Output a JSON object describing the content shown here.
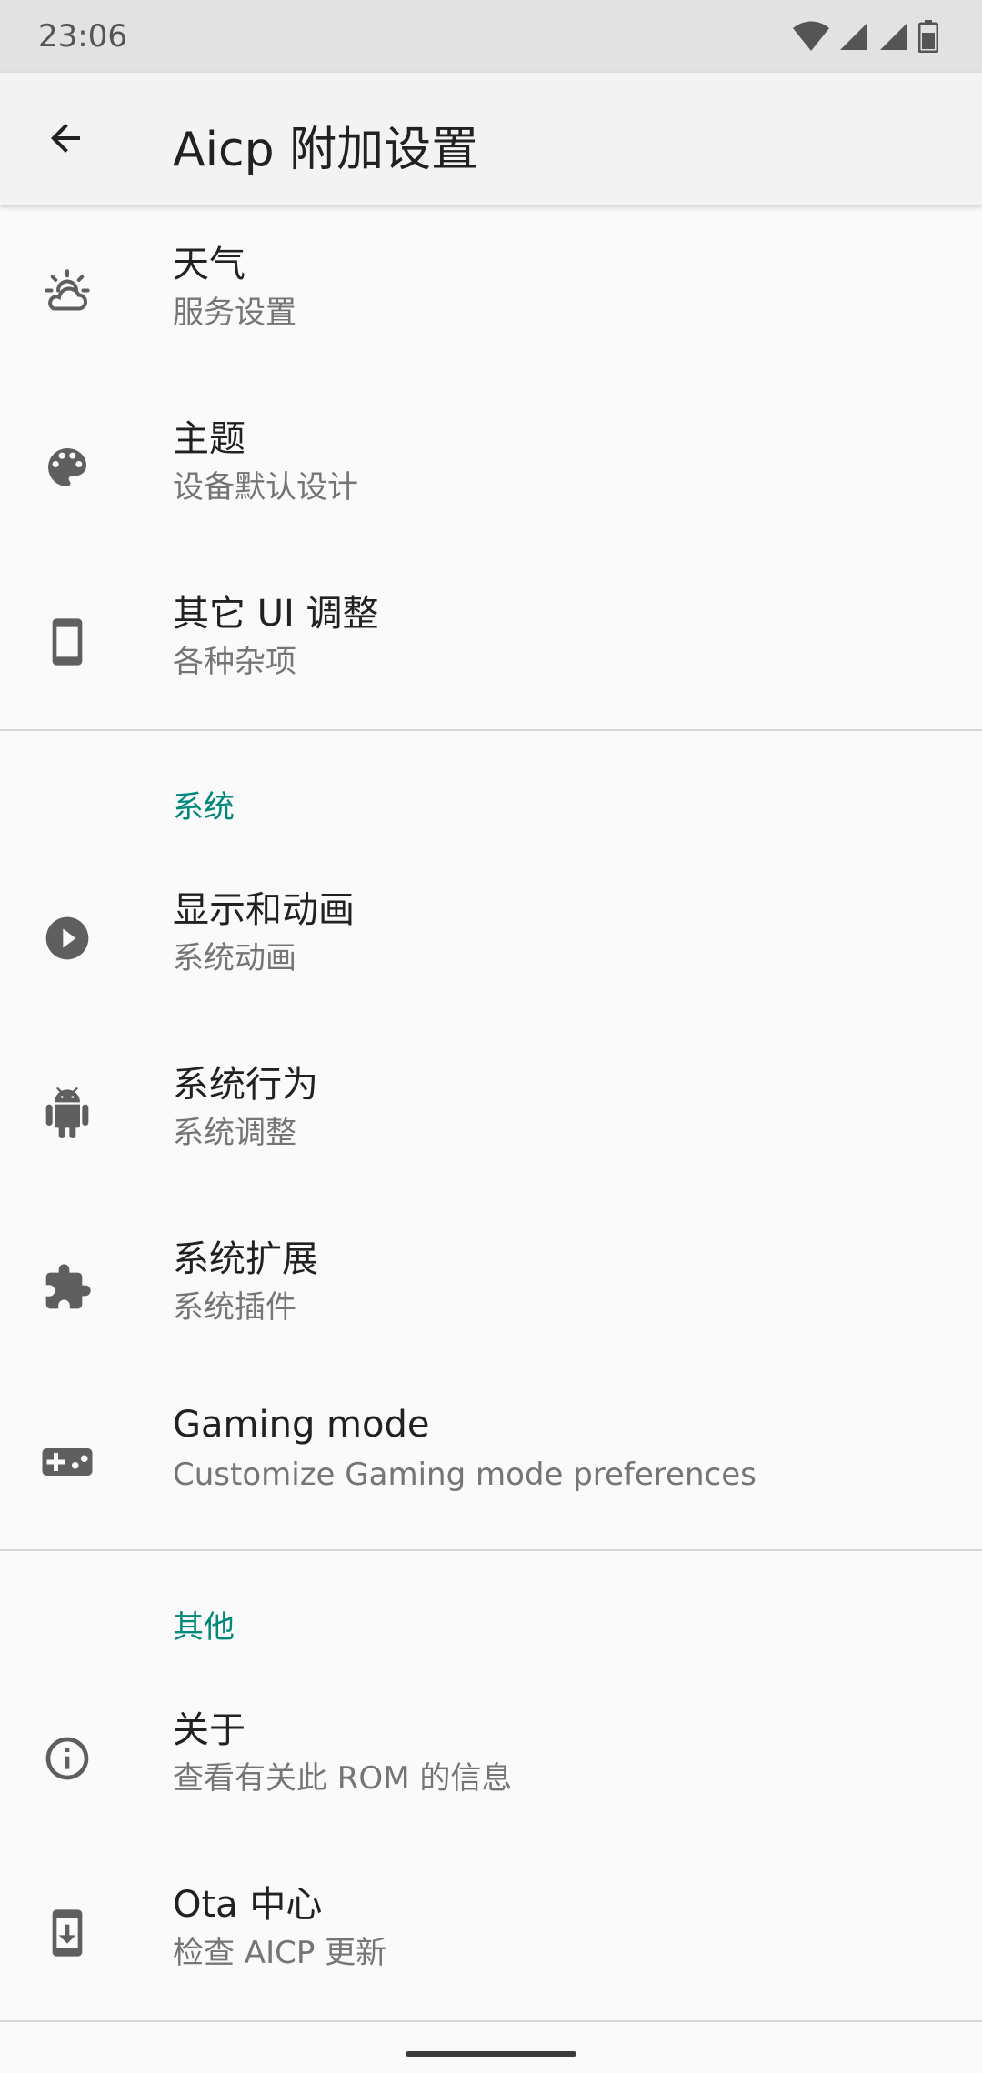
{
  "status": {
    "time": "23:06"
  },
  "appbar": {
    "title": "Aicp 附加设置"
  },
  "items_top": [
    {
      "title": "天气",
      "summary": "服务设置",
      "icon": "weather-icon"
    },
    {
      "title": "主题",
      "summary": "设备默认设计",
      "icon": "palette-icon"
    },
    {
      "title": "其它 UI 调整",
      "summary": "各种杂项",
      "icon": "phone-icon"
    }
  ],
  "system": {
    "title": "系统",
    "items": [
      {
        "title": "显示和动画",
        "summary": "系统动画",
        "icon": "play-icon"
      },
      {
        "title": "系统行为",
        "summary": "系统调整",
        "icon": "android-icon"
      },
      {
        "title": "系统扩展",
        "summary": "系统插件",
        "icon": "puzzle-icon"
      },
      {
        "title": "Gaming mode",
        "summary": "Customize Gaming mode preferences",
        "icon": "gamepad-icon"
      }
    ]
  },
  "other": {
    "title": "其他",
    "items": [
      {
        "title": "关于",
        "summary": "查看有关此 ROM 的信息",
        "icon": "info-icon"
      },
      {
        "title": "Ota 中心",
        "summary": "检查 AICP 更新",
        "icon": "download-icon"
      }
    ]
  },
  "colors": {
    "accent": "#00897b",
    "icon": "#5f5f5f",
    "background": "#fafafa"
  }
}
